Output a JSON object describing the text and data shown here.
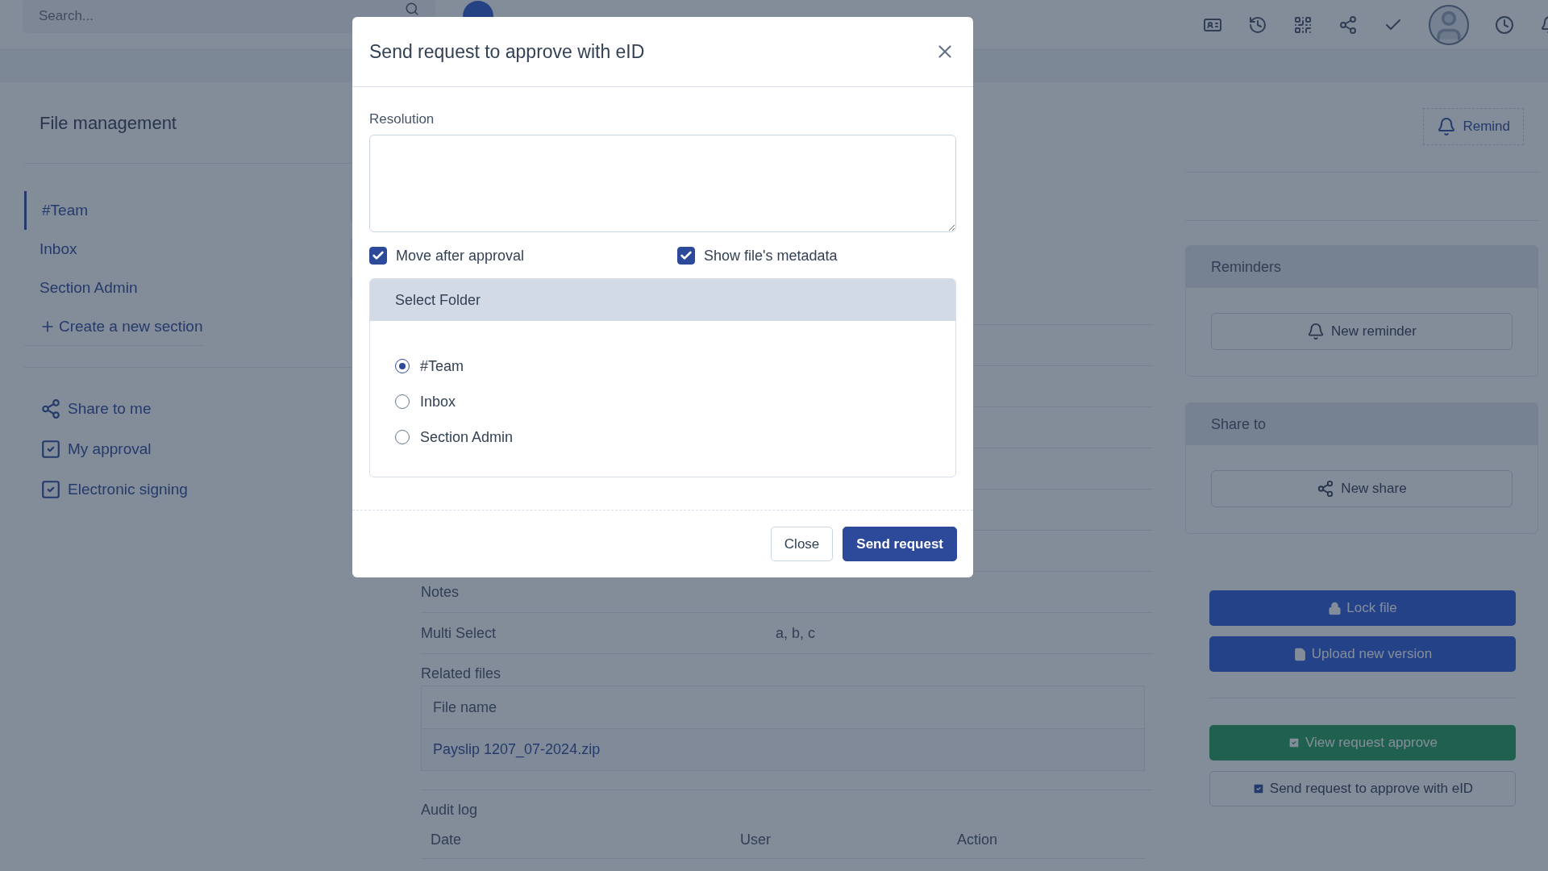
{
  "topbar": {
    "search": {
      "placeholder": "Search..."
    }
  },
  "sidebar": {
    "title": "File management",
    "sections": [
      {
        "label": "#Team",
        "selected": true
      },
      {
        "label": "Inbox",
        "selected": false
      },
      {
        "label": "Section Admin",
        "selected": false
      }
    ],
    "create_link": "Create a new section",
    "nav": [
      {
        "label": "Share to me",
        "kind": "share"
      },
      {
        "label": "My approval",
        "kind": "check"
      },
      {
        "label": "Electronic signing",
        "kind": "check"
      }
    ]
  },
  "main": {
    "fields": [
      {
        "label": "Notes"
      },
      {
        "label": "Multi Select",
        "value": "a, b, c"
      }
    ],
    "related_files": {
      "title": "Related files",
      "columns": [
        "File name"
      ],
      "rows": [
        [
          "Payslip 1207_07-2024.zip"
        ]
      ]
    },
    "audit_log": {
      "title": "Audit log",
      "columns": [
        "Date",
        "User",
        "Action"
      ]
    }
  },
  "right": {
    "remind_button": "Remind",
    "cards": [
      {
        "title": "Reminders",
        "button": "New reminder",
        "kind": "bell"
      },
      {
        "title": "Share to",
        "button": "New share",
        "kind": "share"
      }
    ],
    "actions": [
      {
        "label": "Lock file",
        "kind": "lock"
      },
      {
        "label": "Upload new version",
        "kind": "file"
      }
    ],
    "requests": [
      {
        "label": "View request approve",
        "kind": "success"
      },
      {
        "label": "Send request to approve with eID",
        "kind": "outline"
      }
    ]
  },
  "dialog": {
    "title": "Send request to approve with eID",
    "resolution_label": "Resolution",
    "options": [
      {
        "label": "Move after approval",
        "checked": true
      },
      {
        "label": "Show file's metadata",
        "checked": true
      }
    ],
    "folder_panel": {
      "title": "Select Folder",
      "folders": [
        {
          "label": "#Team",
          "selected": true
        },
        {
          "label": "Inbox",
          "selected": false
        },
        {
          "label": "Section Admin",
          "selected": false
        }
      ]
    },
    "buttons": [
      {
        "label": "Close",
        "kind": "secondary"
      },
      {
        "label": "Send request",
        "kind": "primary"
      }
    ]
  }
}
